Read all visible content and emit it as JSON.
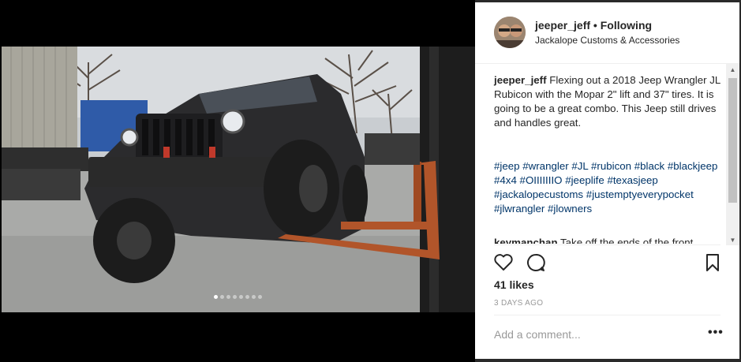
{
  "post": {
    "author": "jeeper_jeff",
    "separator": " • ",
    "follow_status": "Following",
    "location": "Jackalope Customs & Accessories",
    "caption_text": " Flexing out a 2018 Jeep Wrangler JL Rubicon with the Mopar 2\" lift and 37\" tires. It is going to be a great combo. This Jeep still drives and handles great.",
    "hashtags": [
      "#jeep",
      "#wrangler",
      "#JL",
      "#rubicon",
      "#black",
      "#blackjeep",
      "#4x4",
      "#OIIIIIIIO",
      "#jeeplife",
      "#texasjeep",
      "#jackalopecustoms",
      "#justemptyeverypocket",
      "#jlwrangler",
      "#jlowners"
    ],
    "comment_author": "keymanchan",
    "comment_text": " Take off the ends of the front",
    "likes": "41 likes",
    "date": "3 DAYS AGO",
    "add_comment_placeholder": "Add a comment...",
    "more_options": "•••"
  },
  "carousel": {
    "total_slides": 8,
    "active_index": 0
  },
  "colors": {
    "hashtag": "#003569",
    "text": "#262626",
    "muted": "#999999",
    "background": "#000000"
  },
  "icons": [
    "heart-icon",
    "comment-icon",
    "bookmark-icon",
    "scroll-up-arrow",
    "scroll-down-arrow"
  ]
}
